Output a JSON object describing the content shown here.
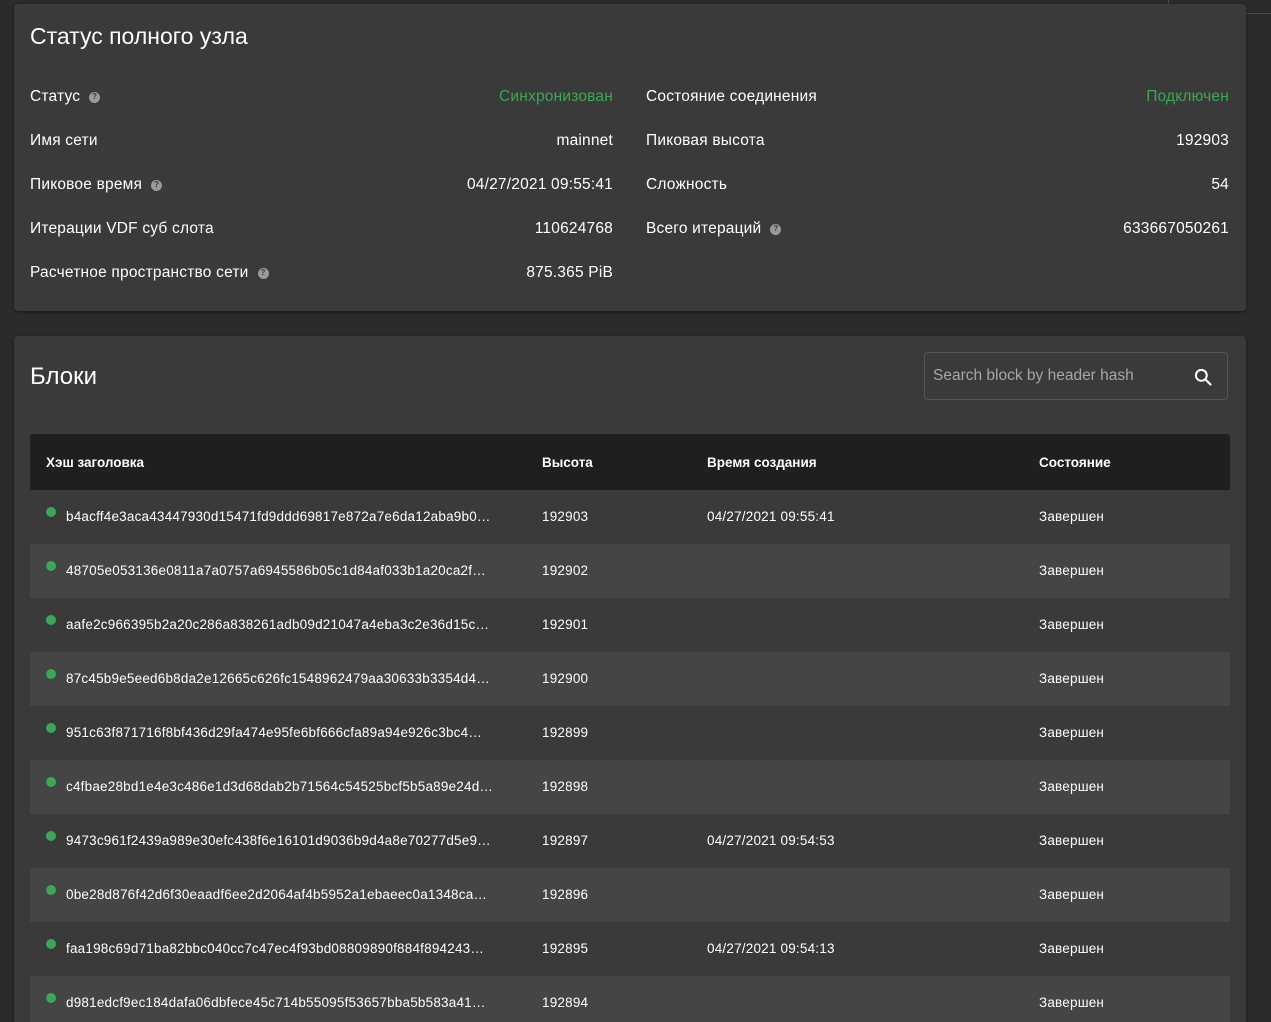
{
  "status_card": {
    "title": "Статус полного узла",
    "left": [
      {
        "label": "Статус",
        "help": true,
        "value": "Синхронизован",
        "green": true
      },
      {
        "label": "Имя сети",
        "help": false,
        "value": "mainnet",
        "green": false
      },
      {
        "label": "Пиковое время",
        "help": true,
        "value": "04/27/2021 09:55:41",
        "green": false
      },
      {
        "label": "Итерации VDF суб слота",
        "help": false,
        "value": "110624768",
        "green": false
      },
      {
        "label": "Расчетное пространство сети",
        "help": true,
        "value": "875.365 PiB",
        "green": false
      }
    ],
    "right": [
      {
        "label": "Состояние соединения",
        "help": false,
        "value": "Подключен",
        "green": true
      },
      {
        "label": "Пиковая высота",
        "help": false,
        "value": "192903",
        "green": false
      },
      {
        "label": "Сложность",
        "help": false,
        "value": "54",
        "green": false
      },
      {
        "label": "Всего итераций",
        "help": true,
        "value": "633667050261",
        "green": false
      }
    ]
  },
  "blocks_card": {
    "title": "Блоки",
    "search": {
      "placeholder": "Search block by header hash",
      "value": "",
      "icon": "search-icon"
    },
    "columns": [
      "Хэш заголовка",
      "Высота",
      "Время создания",
      "Состояние"
    ],
    "rows": [
      {
        "hash": "b4acff4e3aca43447930d15471fd9ddd69817e872a7e6da12aba9b0…",
        "height": "192903",
        "time": "04/27/2021 09:55:41",
        "state": "Завершен"
      },
      {
        "hash": "48705e053136e0811a7a0757a6945586b05c1d84af033b1a20ca2f…",
        "height": "192902",
        "time": "",
        "state": "Завершен"
      },
      {
        "hash": "aafe2c966395b2a20c286a838261adb09d21047a4eba3c2e36d15c…",
        "height": "192901",
        "time": "",
        "state": "Завершен"
      },
      {
        "hash": "87c45b9e5eed6b8da2e12665c626fc1548962479aa30633b3354d4…",
        "height": "192900",
        "time": "",
        "state": "Завершен"
      },
      {
        "hash": "951c63f871716f8bf436d29fa474e95fe6bf666cfa89a94e926c3bc4…",
        "height": "192899",
        "time": "",
        "state": "Завершен"
      },
      {
        "hash": "c4fbae28bd1e4e3c486e1d3d68dab2b71564c54525bcf5b5a89e24d…",
        "height": "192898",
        "time": "",
        "state": "Завершен"
      },
      {
        "hash": "9473c961f2439a989e30efc438f6e16101d9036b9d4a8e70277d5e9…",
        "height": "192897",
        "time": "04/27/2021 09:54:53",
        "state": "Завершен"
      },
      {
        "hash": "0be28d876f42d6f30eaadf6ee2d2064af4b5952a1ebaeec0a1348ca…",
        "height": "192896",
        "time": "",
        "state": "Завершен"
      },
      {
        "hash": "faa198c69d71ba82bbc040cc7c47ec4f93bd08809890f884f894243…",
        "height": "192895",
        "time": "04/27/2021 09:54:13",
        "state": "Завершен"
      },
      {
        "hash": "d981edcf9ec184dafa06dbfece45c714b55095f53657bba5b583a41…",
        "height": "192894",
        "time": "",
        "state": "Завершен"
      }
    ]
  },
  "colors": {
    "background": "#2b2b2b",
    "card": "#3a3a3a",
    "row_alt": "#454545",
    "table_header": "#1f1f1f",
    "accent_green": "#3aa856"
  }
}
